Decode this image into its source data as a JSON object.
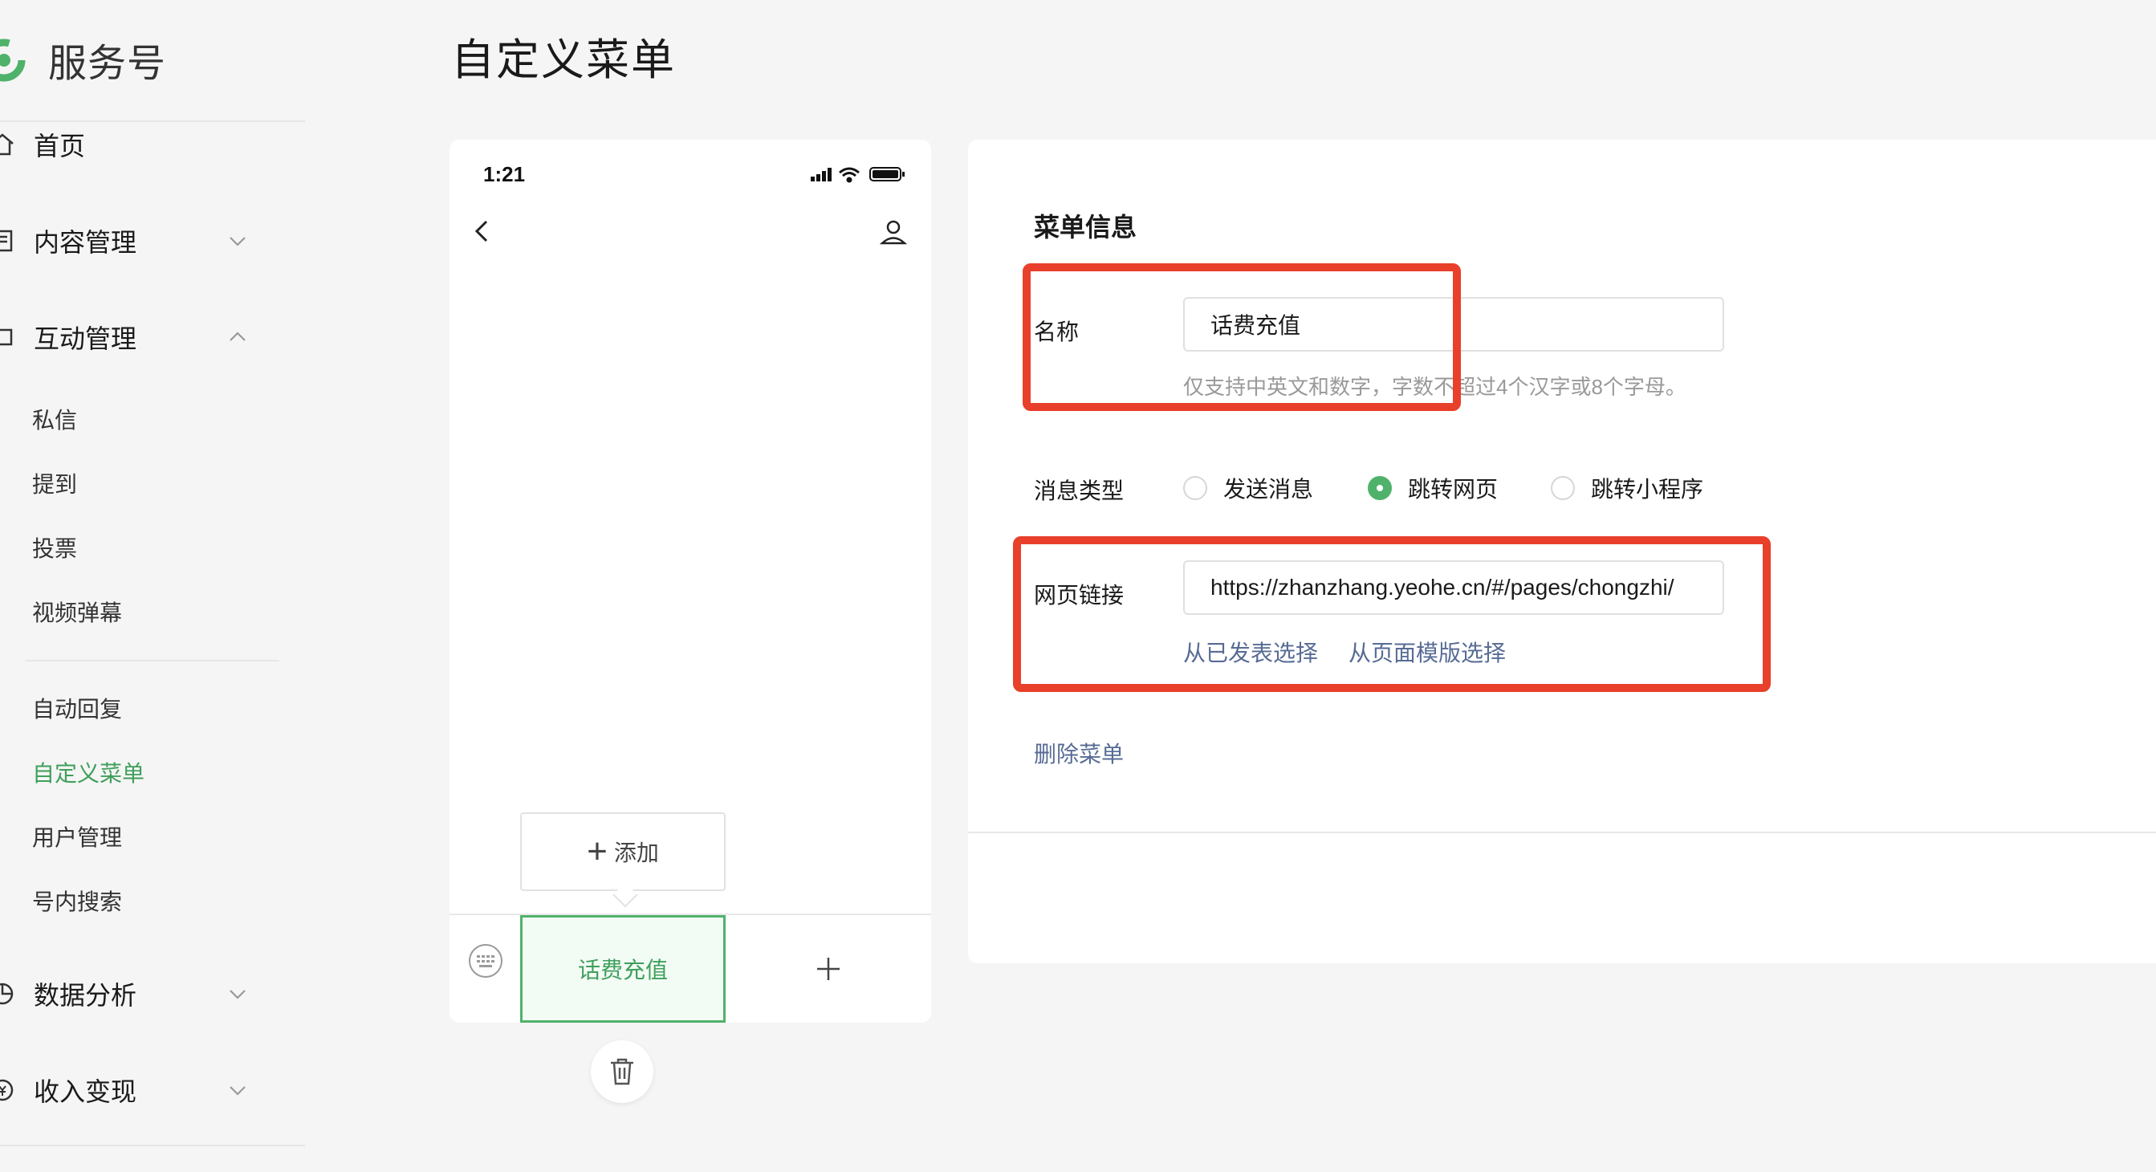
{
  "sidebar": {
    "brand": "服务号",
    "items": [
      {
        "label": "首页"
      },
      {
        "label": "内容管理"
      },
      {
        "label": "互动管理"
      },
      {
        "label": "数据分析"
      },
      {
        "label": "收入变现"
      }
    ],
    "interaction_sub": [
      "私信",
      "提到",
      "投票",
      "视频弹幕"
    ],
    "functions_sub": [
      "自动回复",
      "自定义菜单",
      "用户管理",
      "号内搜索"
    ],
    "active_color": "#3f9f5c"
  },
  "header": {
    "title": "自定义菜单"
  },
  "phone": {
    "time": "1:21",
    "add_label": "添加",
    "menu_item": "话费充值",
    "accent": "#4fb26b"
  },
  "form": {
    "section_title": "菜单信息",
    "name_label": "名称",
    "name_value": "话费充值",
    "name_hint": "仅支持中英文和数字，字数不超过4个汉字或8个字母。",
    "msg_type_label": "消息类型",
    "msg_type_options": [
      "发送消息",
      "跳转网页",
      "跳转小程序"
    ],
    "msg_type_selected": "跳转网页",
    "url_label": "网页链接",
    "url_value": "https://zhanzhang.yeohe.cn/#/pages/chongzhi/",
    "url_links": [
      "从已发表选择",
      "从页面模版选择"
    ],
    "delete_label": "删除菜单",
    "link_color": "#576b95",
    "annotation_color": "#e8402a"
  }
}
